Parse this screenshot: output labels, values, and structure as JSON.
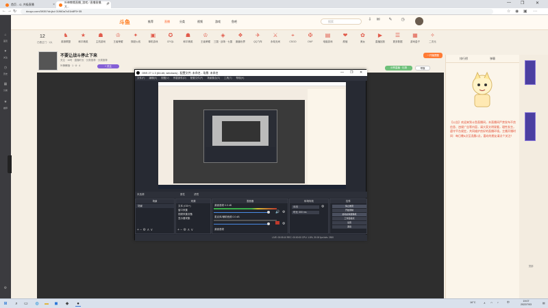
{
  "browser": {
    "tabs": [
      {
        "title": "首页 - 斗, 共极直播",
        "color": "#ff7a1a"
      },
      {
        "title": "叶神教哦直播_游戏 / 直播直播, 大...",
        "color": "#ff7a1a"
      }
    ],
    "new_tab": "+",
    "url": "douyu.com/3935?id=jtui 01960a7c01b8F5+35",
    "window_controls": {
      "minimize": "—",
      "maximize": "❐",
      "close": "✕"
    }
  },
  "site": {
    "logo": "斗鱼",
    "nav": [
      "推荐",
      "直播",
      "分类",
      "视频",
      "游戏",
      "鱼吧"
    ],
    "active_nav": "直播",
    "search_placeholder": "搜索",
    "level": {
      "num": "12",
      "label": "已看过门 · 1大"
    },
    "categories": [
      "英雄联盟",
      "和平精英",
      "主机游戏",
      "王者荣耀",
      "穿越火线",
      "单机游戏",
      "CF/QL",
      "和平精英",
      "王者荣耀",
      "三国 · 战场 · 七国",
      "魔兽世界",
      "QQ飞车",
      "永劫无间",
      "CSGO",
      "DNF",
      "电脑游戏",
      "颜值",
      "美女",
      "直播回放",
      "更多数据",
      "游戏盒子",
      "二次元"
    ],
    "streamer": {
      "title": "不要让战斗停止下来",
      "meta": "关注 · 16时 · 直播时长 · 分类推荐 · 分类推荐",
      "subline": "叶神教哦 · 1 · 8 · 4",
      "follow": "+ 关注",
      "btn_gift": "分享直播 · 礼物",
      "btn_share": "举报",
      "btn_top": "一开播提醒"
    },
    "chat": {
      "tabs": [
        "排行榜",
        "弹幕"
      ],
      "message": "【公告】欢迎来到斗鱼直播间，本直播间严禁发布不良信息、违规广告等内容，请大家文明观看，理性发言，遵守平台规定，共同维护良好的直播环境。主播开播时间：每日晚8点至凌晨2点，喜欢的朋友请点个关注！"
    },
    "rail": [
      "首页",
      "关注",
      "历史",
      "分类",
      "推荐"
    ],
    "back_to_top": "顶部"
  },
  "obs": {
    "title": "OBS 27.1.3 (64-bit, windows) - 配置文件: 未命名 - 场景: 未命名",
    "menu": [
      "文件(F)",
      "编辑(E)",
      "视图(V)",
      "停靠部件(D)",
      "配置文件(P)",
      "场景集合(S)",
      "工具(T)",
      "帮助(H)"
    ],
    "scene_bar": {
      "label": "未选源",
      "props": "属性",
      "filters": "滤镜"
    },
    "docks": {
      "scenes": {
        "title": "场景",
        "items": [
          "场景"
        ]
      },
      "sources": {
        "title": "来源",
        "items": [
          "文本 (GDI+)",
          "窗口采集",
          "视频采集设备",
          "显示器采集"
        ]
      },
      "mixer": {
        "title": "混音器",
        "items": [
          "桌面音频 0.0 dB",
          "麦克风/辅助音频 0.0 dB",
          "桌面音频"
        ]
      },
      "transitions": {
        "title": "转场特效",
        "items": [
          "淡出",
          "时长 300 ms"
        ]
      },
      "controls": {
        "title": "控件",
        "items": [
          "停止推流",
          "开始录制",
          "启动虚拟摄像机",
          "工作室模式",
          "设置",
          "退出"
        ]
      }
    },
    "status": "LIVE: 00:05:10   REC: 00:00:00   CPU: 1.8%, 30.00 fps   kb/s: 2500"
  },
  "taskbar": {
    "apps": [
      "start",
      "search",
      "task-view",
      "edge",
      "explorer",
      "store",
      "chat",
      "obs"
    ],
    "weather": "16°C",
    "lang": "中",
    "time": "19:07",
    "date": "2022/7/03"
  }
}
